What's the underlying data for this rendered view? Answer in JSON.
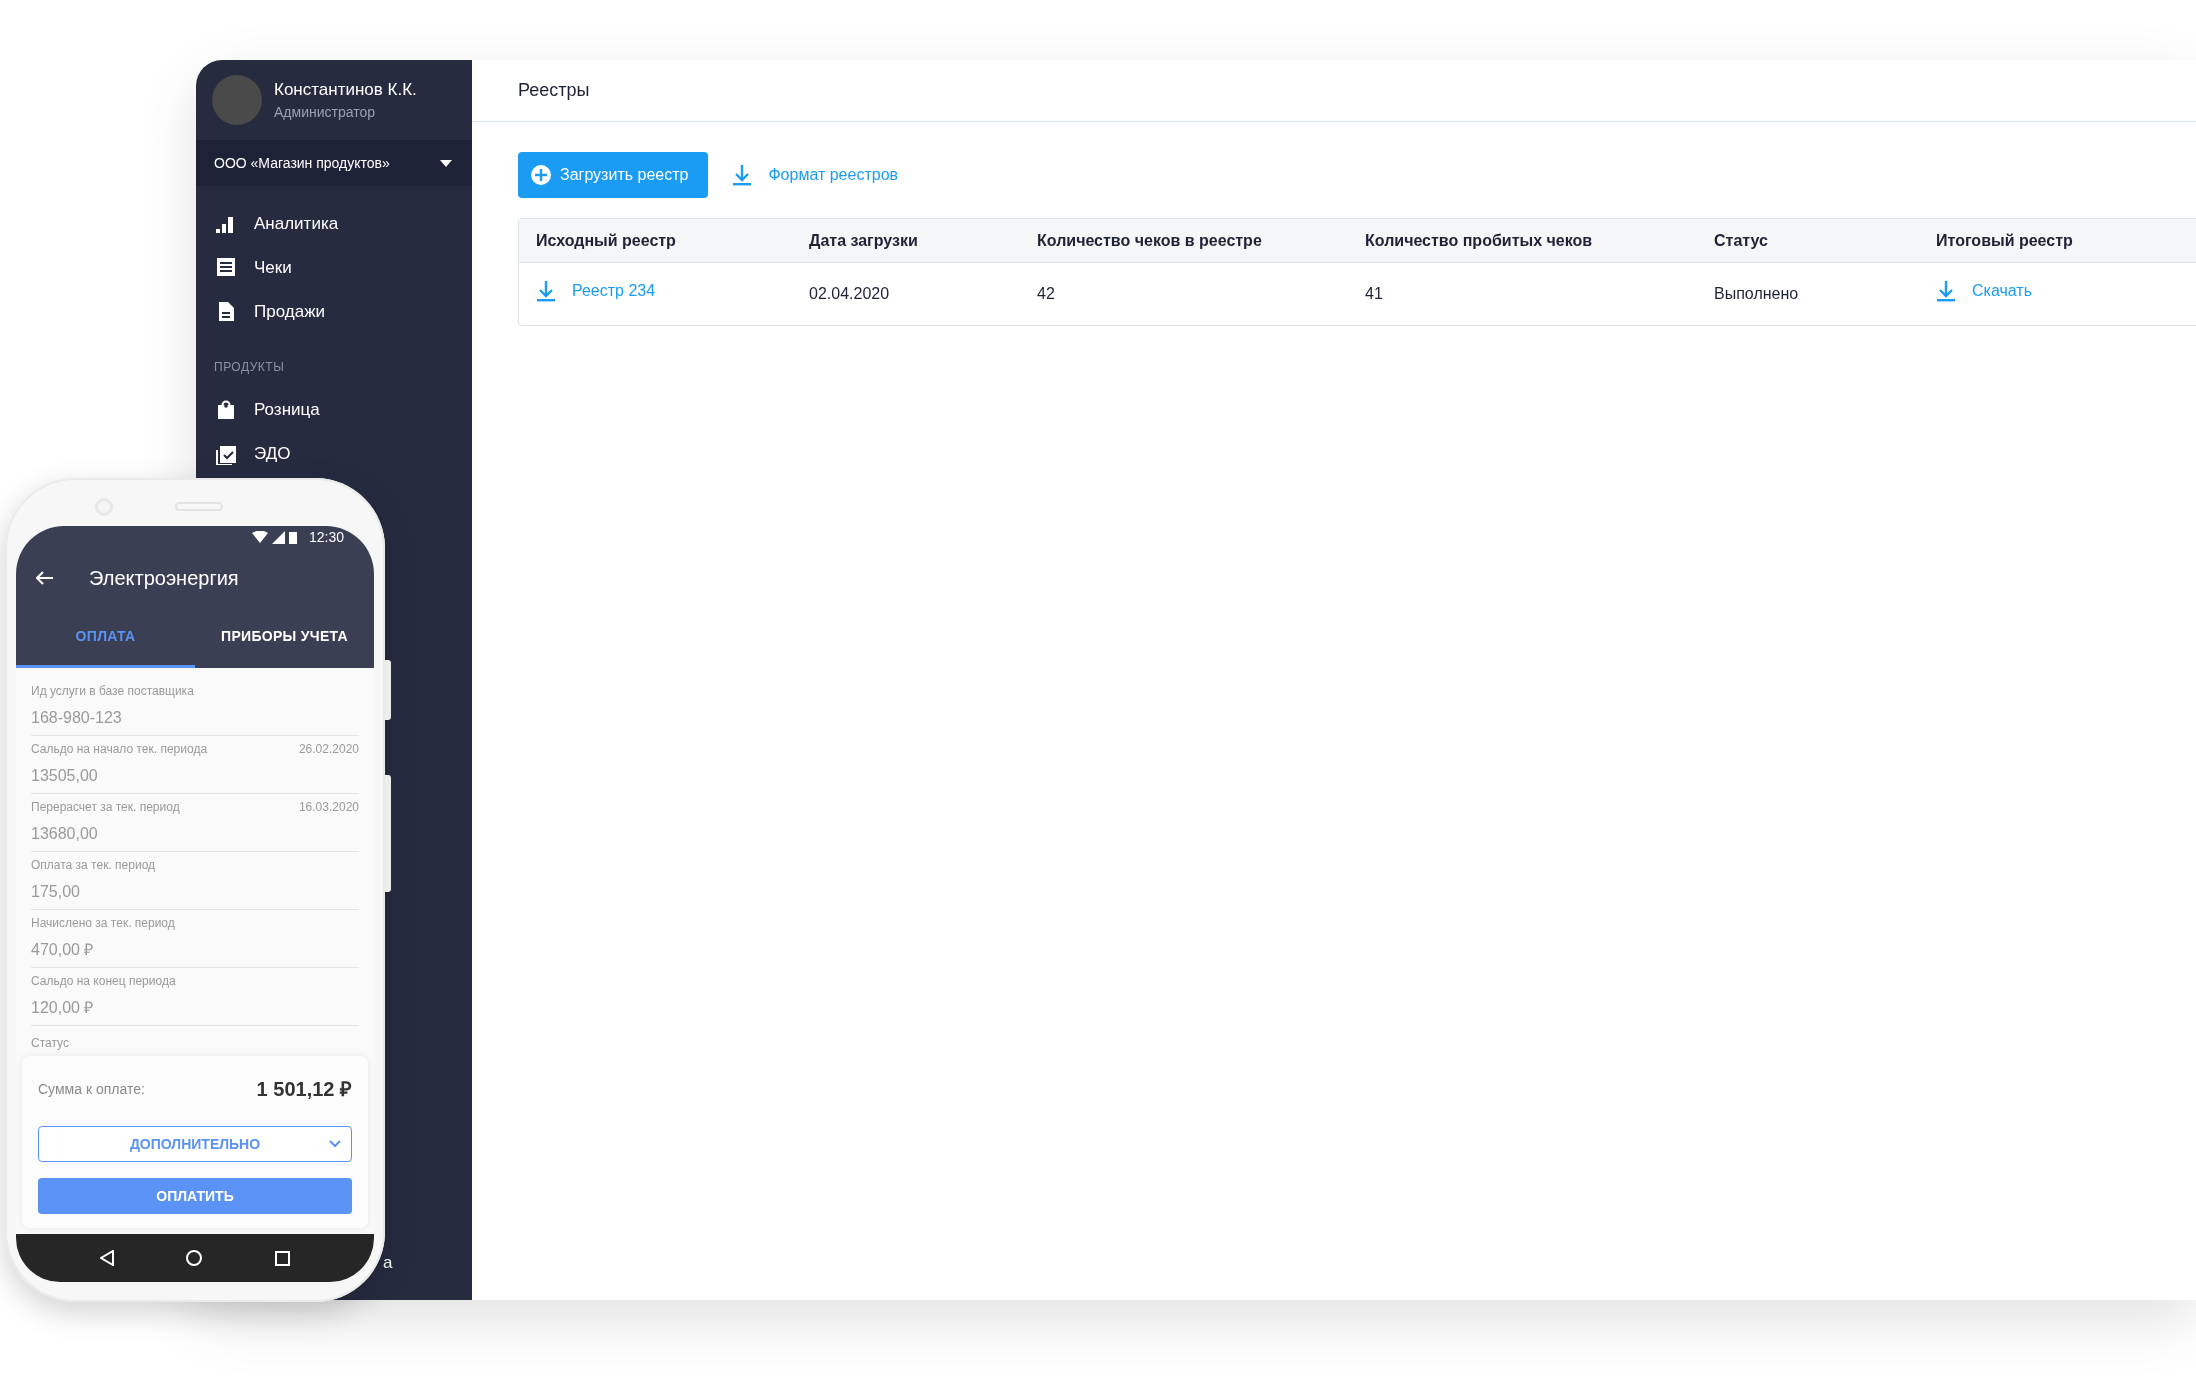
{
  "user": {
    "name": "Константинов К.К.",
    "role": "Администратор"
  },
  "organization": {
    "label": "ООО «Магазин продуктов»"
  },
  "nav": [
    {
      "label": "Аналитика",
      "kind": "chart"
    },
    {
      "label": "Чеки",
      "kind": "receipt"
    },
    {
      "label": "Продажи",
      "kind": "document"
    }
  ],
  "section_title": "ПРОДУКТЫ",
  "products": [
    {
      "label": "Розница",
      "kind": "bag"
    },
    {
      "label": "ЭДО",
      "kind": "clipboard"
    }
  ],
  "sidebar_footer_fragment": "а",
  "page": {
    "title": "Реестры",
    "upload_button": "Загрузить реестр",
    "format_link": "Формат реестров"
  },
  "table": {
    "columns": [
      "Исходный реестр",
      "Дата загрузки",
      "Количество чеков в реестре",
      "Количество пробитых чеков",
      "Статус",
      "Итоговый реестр"
    ],
    "rows": [
      {
        "source": "Реестр 234",
        "date": "02.04.2020",
        "receipts": "42",
        "punched": "41",
        "status": "Выполнено",
        "result": "Скачать"
      }
    ]
  },
  "phone": {
    "status_time": "12:30",
    "title": "Электроэнергия",
    "tabs": [
      {
        "label": "ОПЛАТА",
        "selected": true
      },
      {
        "label": "ПРИБОРЫ УЧЕТА",
        "selected": false
      }
    ],
    "fields": [
      {
        "label": "Ид услуги в базе поставщика",
        "value": "168-980-123"
      },
      {
        "label": "Сальдо на начало тек. периода",
        "date": "26.02.2020",
        "value": "13505,00"
      },
      {
        "label": "Перерасчет за тек. период",
        "date": "16.03.2020",
        "value": "13680,00"
      },
      {
        "label": "Оплата за тек. период",
        "value": "175,00"
      },
      {
        "label": "Начислено за тек. период",
        "value": "470,00 ₽"
      },
      {
        "label": "Сальдо на конец периода",
        "value": "120,00 ₽"
      }
    ],
    "status_label": "Статус",
    "total_label": "Сумма к оплате:",
    "total": "1 501,12 ₽",
    "more_button": "ДОПОЛНИТЕЛЬНО",
    "pay_button": "ОПЛАТИТЬ"
  }
}
